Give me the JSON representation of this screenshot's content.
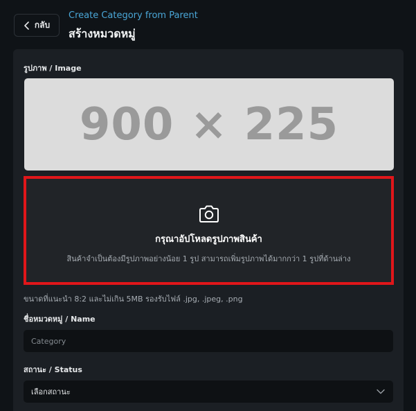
{
  "header": {
    "back_label": "กลับ",
    "subtitle": "Create Category from Parent",
    "title": "สร้างหมวดหมู่"
  },
  "form": {
    "image_label": "รูปภาพ / Image",
    "image_placeholder": "900 × 225",
    "upload_title": "กรุณาอัปโหลดรูปภาพสินค้า",
    "upload_desc": "สินค้าจำเป็นต้องมีรูปภาพอย่างน้อย 1 รูป สามารถเพิ่มรูปภาพได้มากกว่า 1 รูปที่ด้านล่าง",
    "upload_hint": "ขนาดที่แนะนำ 8:2 และไม่เกิน 5MB รองรับไฟล์ .jpg, .jpeg, .png",
    "name_label": "ชื่อหมวดหมู่ / Name",
    "name_placeholder": "Category",
    "status_label": "สถานะ / Status",
    "status_value": "เลือกสถานะ"
  },
  "icons": {
    "back": "chevron-left-icon",
    "camera": "camera-icon",
    "dropdown": "chevron-down-icon"
  },
  "colors": {
    "accent": "#4aa7d8",
    "highlight": "#e0161a",
    "background": "#0f1317",
    "card": "#1b1f24"
  }
}
